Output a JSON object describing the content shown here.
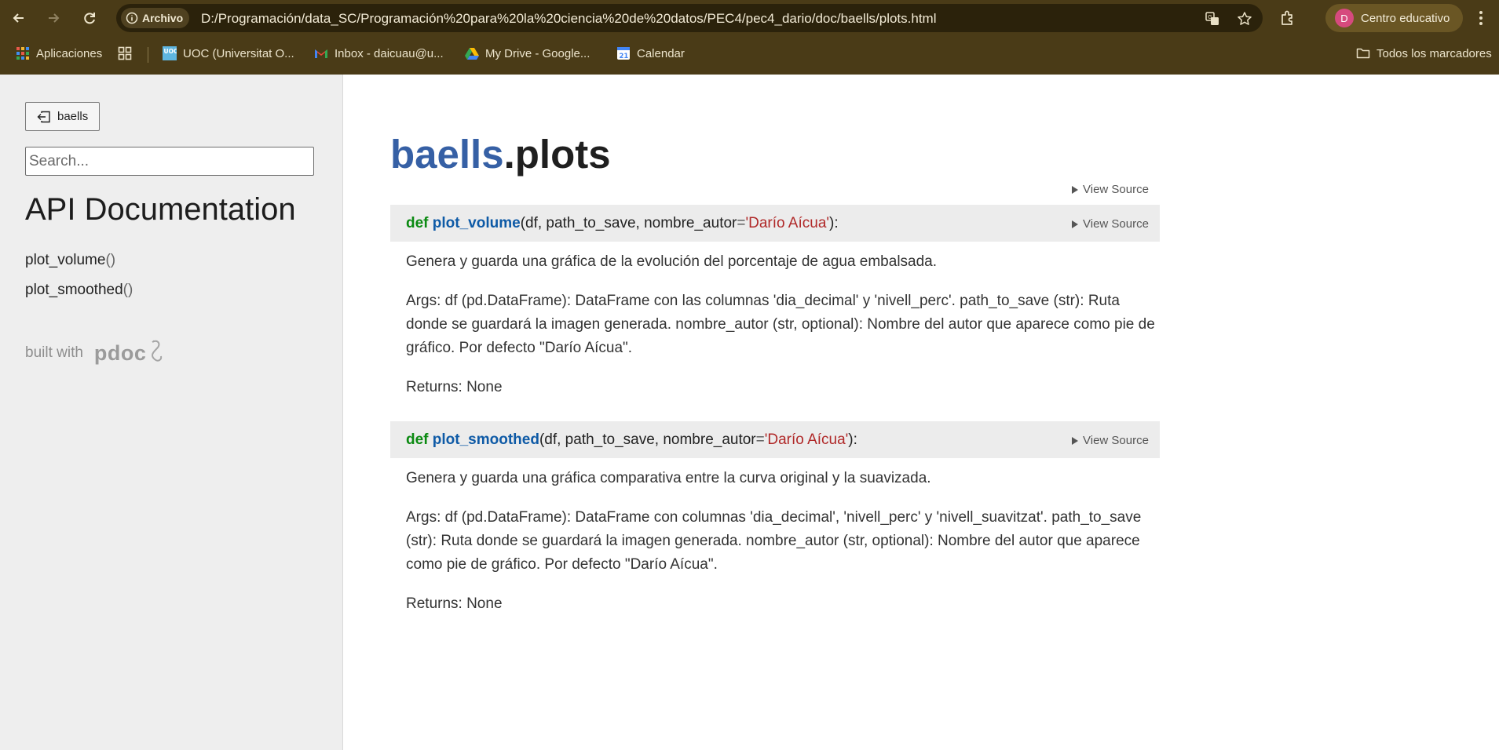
{
  "browser": {
    "archivo_label": "Archivo",
    "url": "D:/Programación/data_SC/Programación%20para%20la%20ciencia%20de%20datos/PEC4/pec4_dario/doc/baells/plots.html",
    "profile_initial": "D",
    "profile_label": "Centro educativo",
    "bookmarks": [
      {
        "label": "Aplicaciones",
        "icon": "apps-grid-icon"
      },
      {
        "label": "UOC (Universitat O...",
        "icon": "uoc-icon"
      },
      {
        "label": "Inbox - daicuau@u...",
        "icon": "gmail-icon"
      },
      {
        "label": "My Drive - Google...",
        "icon": "drive-icon"
      },
      {
        "label": "Calendar",
        "icon": "calendar-icon",
        "icon_text": "21"
      }
    ],
    "all_bookmarks_label": "Todos los marcadores"
  },
  "sidebar": {
    "back_label": "baells",
    "search_placeholder": "Search...",
    "title": "API Documentation",
    "functions": [
      {
        "name": "plot_volume",
        "parens": "()"
      },
      {
        "name": "plot_smoothed",
        "parens": "()"
      }
    ],
    "built_with": "built with",
    "logo_text": "pdoc"
  },
  "main": {
    "module_pkg": "baells",
    "module_name": ".plots",
    "view_source_label": "View Source",
    "functions": [
      {
        "keyword": "def",
        "name": "plot_volume",
        "params_open": "(df, path_to_save, nombre_autor",
        "eq": "=",
        "default": "'Darío Aícua'",
        "params_close": "):",
        "summary": "Genera y guarda una gráfica de la evolución del porcentaje de agua embalsada.",
        "args": "Args: df (pd.DataFrame): DataFrame con las columnas 'dia_decimal' y 'nivell_perc'. path_to_save (str): Ruta donde se guardará la imagen generada. nombre_autor (str, optional): Nombre del autor que aparece como pie de gráfico. Por defecto \"Darío Aícua\".",
        "returns": "Returns: None"
      },
      {
        "keyword": "def",
        "name": "plot_smoothed",
        "params_open": "(df, path_to_save, nombre_autor",
        "eq": "=",
        "default": "'Darío Aícua'",
        "params_close": "):",
        "summary": "Genera y guarda una gráfica comparativa entre la curva original y la suavizada.",
        "args": "Args: df (pd.DataFrame): DataFrame con columnas 'dia_decimal', 'nivell_perc' y 'nivell_suavitzat'. path_to_save (str): Ruta donde se guardará la imagen generada. nombre_autor (str, optional): Nombre del autor que aparece como pie de gráfico. Por defecto \"Darío Aícua\".",
        "returns": "Returns: None"
      }
    ]
  }
}
